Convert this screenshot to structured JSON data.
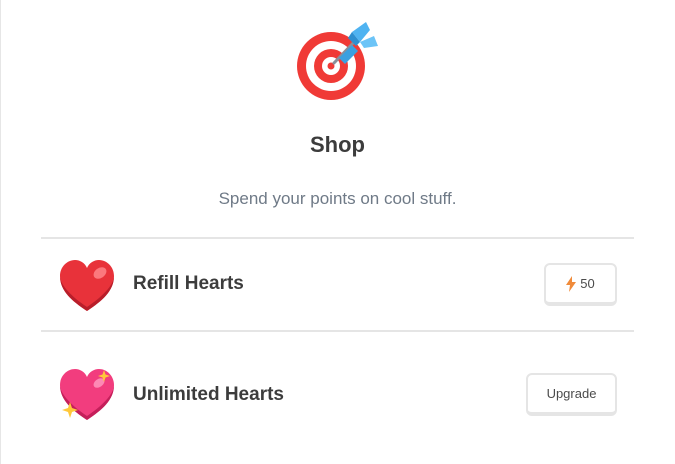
{
  "header": {
    "icon": "target-dart-icon",
    "title": "Shop",
    "subtitle": "Spend your points on cool stuff."
  },
  "items": [
    {
      "icon": "red-heart-icon",
      "label": "Refill Hearts",
      "action_icon": "lightning-bolt-icon",
      "action_label": "50"
    },
    {
      "icon": "sparkling-heart-icon",
      "label": "Unlimited Hearts",
      "action_label": "Upgrade"
    }
  ],
  "colors": {
    "title": "#3c3c3c",
    "subtitle": "#6f7a87",
    "divider": "#e5e5e5",
    "bolt": "#f08b3a",
    "heart": "#e8323a",
    "sparkle_heart": "#f23d7e",
    "target_red": "#f03a36",
    "dart_blue": "#4fb3f1"
  }
}
